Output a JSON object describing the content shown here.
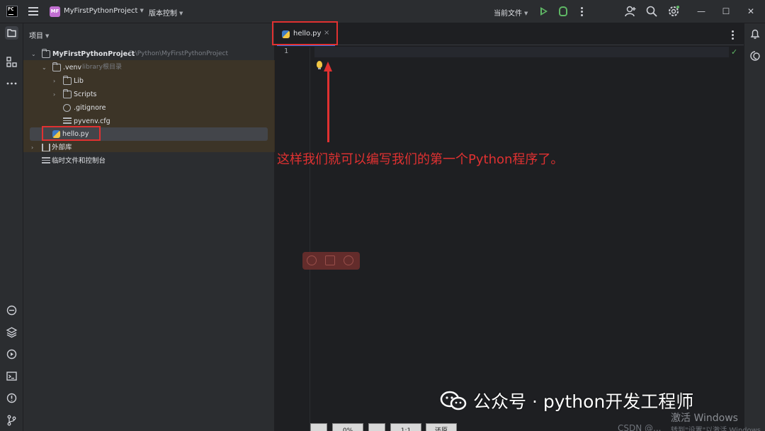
{
  "titlebar": {
    "project_badge": "MF",
    "project_name": "MyFirstPythonProject",
    "vcs_label": "版本控制",
    "current_file_label": "当前文件"
  },
  "project_panel": {
    "header": "项目",
    "root_name": "MyFirstPythonProject",
    "root_path": "E:\\Python\\MyFirstPythonProject",
    "venv_name": ".venv",
    "venv_note": "library根目录",
    "lib": "Lib",
    "scripts": "Scripts",
    "gitignore": ".gitignore",
    "pyvenv": "pyvenv.cfg",
    "hello": "hello.py",
    "external_libs": "外部库",
    "scratches": "临时文件和控制台"
  },
  "editor": {
    "tab_label": "hello.py",
    "tab_close": "×",
    "line_number": "1",
    "check": "✓",
    "annotation": "这样我们就可以编写我们的第一个Python程序了。"
  },
  "bottom_buttons": [
    "",
    "0%",
    "",
    "1:1",
    "还原"
  ],
  "overlay": {
    "watermark": "公众号 · python开发工程师",
    "activate": "激活 Windows",
    "activate_sub": "转到\"设置\"以激活 Windows",
    "csdn": "CSDN @..."
  },
  "colors": {
    "accent": "#3574f0",
    "annotation_red": "#e03131",
    "run_green": "#5fb865",
    "venv_highlight": "#4a3a20"
  }
}
